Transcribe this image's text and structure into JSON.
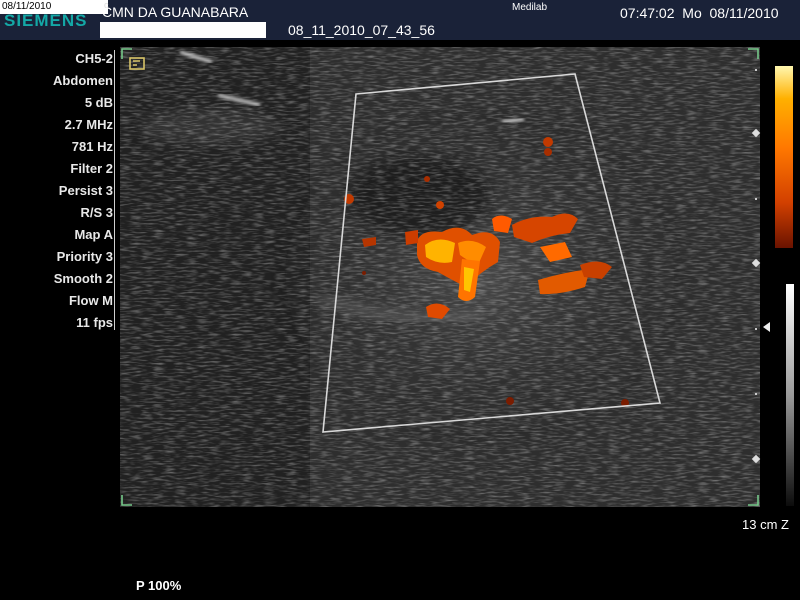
{
  "header": {
    "date_short": "08/11/2010",
    "brand": "SIEMENS",
    "brand_tick": "c",
    "clinic": "CMN DA GUANABARA",
    "study_id": "08_11_2010_07_43_56",
    "vendor": "Medilab",
    "clock": "07:47:02  Mo  08/11/2010"
  },
  "params": [
    "CH5-2",
    "Abdomen",
    "5 dB",
    "2.7 MHz",
    "781 Hz",
    "Filter 2",
    "Persist 3",
    "R/S 3",
    "Map A",
    "Priority 3",
    "Smooth 2",
    "Flow M",
    "11 fps"
  ],
  "footer": {
    "depth": "13 cm Z",
    "power": "P 100%"
  },
  "colors": {
    "header_bg": "#1a2238",
    "brand": "#14a8a6",
    "doppler_hot": "#ff6a00"
  }
}
